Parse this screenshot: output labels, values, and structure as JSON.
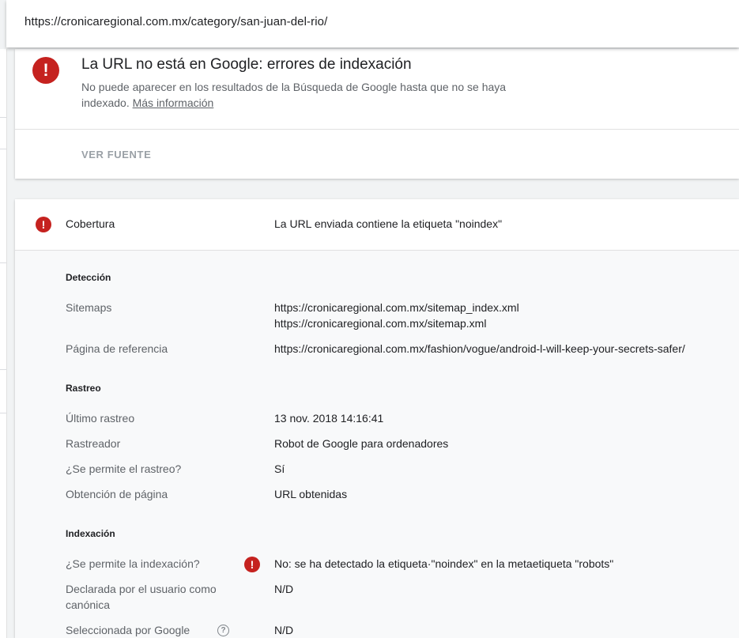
{
  "address_bar": {
    "url": "https://cronicaregional.com.mx/category/san-juan-del-rio/"
  },
  "status_card": {
    "icon": "error-icon",
    "title": "La URL no está en Google: errores de indexación",
    "description": "No puede aparecer en los resultados de la Búsqueda de Google hasta que no se haya indexado.",
    "more_info_link": "Más información",
    "view_source_button": "VER FUENTE"
  },
  "coverage": {
    "label": "Cobertura",
    "value": "La URL enviada contiene la etiqueta \"noindex\"",
    "sections": {
      "detection": {
        "title": "Detección",
        "sitemaps_label": "Sitemaps",
        "sitemaps_values": [
          "https://cronicaregional.com.mx/sitemap_index.xml",
          "https://cronicaregional.com.mx/sitemap.xml"
        ],
        "referring_page_label": "Página de referencia",
        "referring_page_value": "https://cronicaregional.com.mx/fashion/vogue/android-l-will-keep-your-secrets-safer/"
      },
      "crawl": {
        "title": "Rastreo",
        "last_crawl_label": "Último rastreo",
        "last_crawl_value": "13 nov. 2018 14:16:41",
        "crawler_label": "Rastreador",
        "crawler_value": "Robot de Google para ordenadores",
        "crawl_allowed_label": "¿Se permite el rastreo?",
        "crawl_allowed_value": "Sí",
        "page_fetch_label": "Obtención de página",
        "page_fetch_value": "URL obtenidas"
      },
      "indexing": {
        "title": "Indexación",
        "indexing_allowed_label": "¿Se permite la indexación?",
        "indexing_allowed_value": "No: se ha detectado la etiqueta·\"noindex\" en la metaetiqueta \"robots\"",
        "user_canonical_label": "Declarada por el usuario como canónica",
        "user_canonical_value": "N/D",
        "google_canonical_label": "Seleccionada por Google",
        "google_canonical_value": "N/D"
      }
    }
  },
  "colors": {
    "error": "#c5221f",
    "muted_text": "#5f6368",
    "primary_text": "#202124"
  }
}
